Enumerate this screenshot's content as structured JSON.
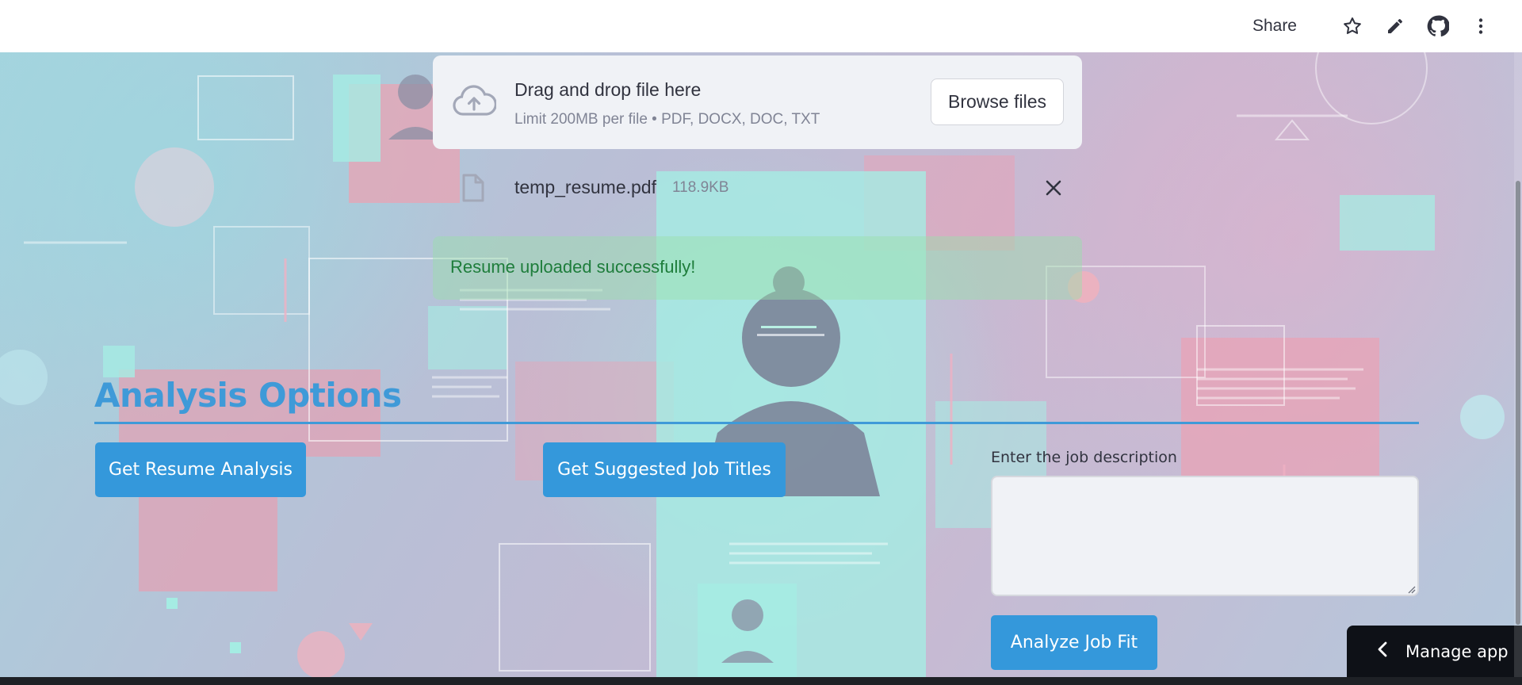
{
  "topbar": {
    "share_label": "Share",
    "icons": [
      "star-icon",
      "pencil-icon",
      "github-icon",
      "more-vertical-icon"
    ]
  },
  "uploader": {
    "drop_title": "Drag and drop file here",
    "limit_text": "Limit 200MB per file • PDF, DOCX, DOC, TXT",
    "browse_label": "Browse files",
    "file": {
      "name": "temp_resume.pdf",
      "size": "118.9KB"
    }
  },
  "status": {
    "success_message": "Resume uploaded successfully!"
  },
  "analysis": {
    "title": "Analysis Options",
    "resume_button": "Get Resume Analysis",
    "titles_button": "Get Suggested Job Titles",
    "job_description_label": "Enter the job description",
    "job_description_value": "",
    "fit_button": "Analyze Job Fit"
  },
  "footer": {
    "manage_app_label": "Manage app"
  },
  "colors": {
    "accent": "#3498db",
    "title": "#3f9ad8",
    "success_text": "#1e7d3b",
    "success_bg": "#9ae0aa"
  }
}
